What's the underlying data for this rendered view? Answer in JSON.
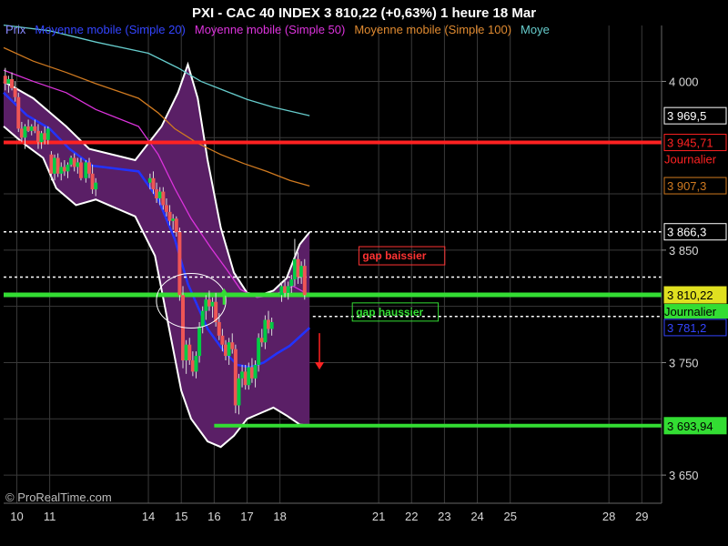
{
  "title": "PXI - CAC 40 INDEX     3 810,22 (+0,63%)     1 heure  18 Mar",
  "watermark": "© ProRealTime.com",
  "colors": {
    "background": "#000000",
    "band_fill": "#5a1f66",
    "band_edge": "#ffffff",
    "ma20": "#2233ff",
    "ma50": "#dd33dd",
    "ma100": "#d07a20",
    "ma200": "#66cccc",
    "candle_up": "#00cc44",
    "candle_down": "#ee5555",
    "red_line": "#ff2222",
    "green_line": "#33dd33"
  },
  "legend": [
    {
      "label": "Prix",
      "color": "#8888ff"
    },
    {
      "label": "Moyenne mobile (Simple 20)",
      "color": "#3344ff"
    },
    {
      "label": "Moyenne mobile (Simple 50)",
      "color": "#dd33dd"
    },
    {
      "label": "Moyenne mobile (Simple 100)",
      "color": "#e08a30"
    },
    {
      "label": "Moye",
      "color": "#66cccc"
    }
  ],
  "chart_data": {
    "type": "candlestick",
    "x_ticks": [
      {
        "label": "10",
        "x": 10
      },
      {
        "label": "11",
        "x": 11
      },
      {
        "label": "14",
        "x": 14
      },
      {
        "label": "15",
        "x": 15
      },
      {
        "label": "16",
        "x": 16
      },
      {
        "label": "17",
        "x": 17
      },
      {
        "label": "18",
        "x": 18
      },
      {
        "label": "21",
        "x": 21
      },
      {
        "label": "22",
        "x": 22
      },
      {
        "label": "23",
        "x": 23
      },
      {
        "label": "24",
        "x": 24
      },
      {
        "label": "25",
        "x": 25
      },
      {
        "label": "28",
        "x": 28
      },
      {
        "label": "29",
        "x": 29
      }
    ],
    "xlim": [
      9.6,
      29.6
    ],
    "ylim": [
      3625,
      4040
    ],
    "y_ticks": [
      {
        "label": "4 000",
        "value": 4000
      },
      {
        "label": "3 850",
        "value": 3850
      },
      {
        "label": "3 750",
        "value": 3750
      },
      {
        "label": "3 650",
        "value": 3650
      }
    ],
    "price_boxes": [
      {
        "label": "3 969,5",
        "value": 3969.5,
        "color": "#ffffff",
        "sub": ""
      },
      {
        "label": "3 945,71",
        "value": 3945.71,
        "color": "#ff2222",
        "sub": "Journalier"
      },
      {
        "label": "3 907,3",
        "value": 3907.3,
        "color": "#d07a20",
        "sub": ""
      },
      {
        "label": "3 866,3",
        "value": 3866.3,
        "color": "#ffffff",
        "sub": ""
      },
      {
        "label": "3 810,22",
        "value": 3810.22,
        "color": "#e0e020",
        "sub": ""
      },
      {
        "label": "3 781,2",
        "value": 3781.2,
        "color": "#3344ff",
        "sub": ""
      },
      {
        "label": "3 693,94",
        "value": 3693.94,
        "color": "#33dd33",
        "sub": ""
      }
    ],
    "green_sub_label": "Journalier",
    "candles": [
      {
        "x": 9.65,
        "o": 4005,
        "h": 4012,
        "l": 3992,
        "c": 3998
      },
      {
        "x": 9.75,
        "o": 3998,
        "h": 4005,
        "l": 3990,
        "c": 4002
      },
      {
        "x": 9.85,
        "o": 4002,
        "h": 4008,
        "l": 3992,
        "c": 3994
      },
      {
        "x": 9.95,
        "o": 3994,
        "h": 4000,
        "l": 3982,
        "c": 3986
      },
      {
        "x": 10.05,
        "o": 3986,
        "h": 3990,
        "l": 3955,
        "c": 3958
      },
      {
        "x": 10.15,
        "o": 3958,
        "h": 3964,
        "l": 3946,
        "c": 3950
      },
      {
        "x": 10.25,
        "o": 3950,
        "h": 3962,
        "l": 3940,
        "c": 3960
      },
      {
        "x": 10.35,
        "o": 3960,
        "h": 3966,
        "l": 3955,
        "c": 3956
      },
      {
        "x": 10.45,
        "o": 3956,
        "h": 3962,
        "l": 3952,
        "c": 3960
      },
      {
        "x": 10.55,
        "o": 3960,
        "h": 3966,
        "l": 3954,
        "c": 3956
      },
      {
        "x": 10.65,
        "o": 3956,
        "h": 3962,
        "l": 3940,
        "c": 3946
      },
      {
        "x": 10.75,
        "o": 3946,
        "h": 3956,
        "l": 3940,
        "c": 3954
      },
      {
        "x": 10.85,
        "o": 3954,
        "h": 3960,
        "l": 3944,
        "c": 3948
      },
      {
        "x": 10.95,
        "o": 3948,
        "h": 3960,
        "l": 3944,
        "c": 3958
      },
      {
        "x": 11.05,
        "o": 3935,
        "h": 3938,
        "l": 3912,
        "c": 3918
      },
      {
        "x": 11.15,
        "o": 3918,
        "h": 3935,
        "l": 3912,
        "c": 3932
      },
      {
        "x": 11.25,
        "o": 3932,
        "h": 3936,
        "l": 3915,
        "c": 3918
      },
      {
        "x": 11.35,
        "o": 3918,
        "h": 3928,
        "l": 3912,
        "c": 3924
      },
      {
        "x": 11.45,
        "o": 3924,
        "h": 3930,
        "l": 3916,
        "c": 3920
      },
      {
        "x": 11.55,
        "o": 3920,
        "h": 3928,
        "l": 3914,
        "c": 3926
      },
      {
        "x": 11.65,
        "o": 3926,
        "h": 3934,
        "l": 3924,
        "c": 3932
      },
      {
        "x": 11.75,
        "o": 3932,
        "h": 3936,
        "l": 3920,
        "c": 3924
      },
      {
        "x": 11.85,
        "o": 3924,
        "h": 3932,
        "l": 3918,
        "c": 3928
      },
      {
        "x": 11.95,
        "o": 3928,
        "h": 3932,
        "l": 3912,
        "c": 3914
      },
      {
        "x": 12.1,
        "o": 3914,
        "h": 3930,
        "l": 3910,
        "c": 3928
      },
      {
        "x": 12.2,
        "o": 3928,
        "h": 3932,
        "l": 3914,
        "c": 3918
      },
      {
        "x": 12.3,
        "o": 3918,
        "h": 3926,
        "l": 3900,
        "c": 3904
      },
      {
        "x": 12.4,
        "o": 3904,
        "h": 3914,
        "l": 3898,
        "c": 3910
      },
      {
        "x": 14.05,
        "o": 3910,
        "h": 3918,
        "l": 3904,
        "c": 3914
      },
      {
        "x": 14.15,
        "o": 3914,
        "h": 3920,
        "l": 3900,
        "c": 3904
      },
      {
        "x": 14.25,
        "o": 3904,
        "h": 3910,
        "l": 3892,
        "c": 3896
      },
      {
        "x": 14.35,
        "o": 3896,
        "h": 3906,
        "l": 3890,
        "c": 3902
      },
      {
        "x": 14.45,
        "o": 3902,
        "h": 3906,
        "l": 3886,
        "c": 3890
      },
      {
        "x": 14.55,
        "o": 3890,
        "h": 3896,
        "l": 3880,
        "c": 3884
      },
      {
        "x": 14.65,
        "o": 3884,
        "h": 3890,
        "l": 3872,
        "c": 3876
      },
      {
        "x": 14.75,
        "o": 3876,
        "h": 3882,
        "l": 3868,
        "c": 3878
      },
      {
        "x": 14.85,
        "o": 3878,
        "h": 3880,
        "l": 3862,
        "c": 3866
      },
      {
        "x": 14.95,
        "o": 3866,
        "h": 3870,
        "l": 3805,
        "c": 3810
      },
      {
        "x": 15.05,
        "o": 3810,
        "h": 3818,
        "l": 3745,
        "c": 3752
      },
      {
        "x": 15.15,
        "o": 3752,
        "h": 3770,
        "l": 3740,
        "c": 3766
      },
      {
        "x": 15.25,
        "o": 3766,
        "h": 3772,
        "l": 3748,
        "c": 3752
      },
      {
        "x": 15.35,
        "o": 3752,
        "h": 3760,
        "l": 3738,
        "c": 3742
      },
      {
        "x": 15.45,
        "o": 3742,
        "h": 3760,
        "l": 3736,
        "c": 3756
      },
      {
        "x": 15.55,
        "o": 3756,
        "h": 3786,
        "l": 3750,
        "c": 3782
      },
      {
        "x": 15.65,
        "o": 3782,
        "h": 3800,
        "l": 3776,
        "c": 3796
      },
      {
        "x": 15.75,
        "o": 3796,
        "h": 3810,
        "l": 3788,
        "c": 3806
      },
      {
        "x": 15.85,
        "o": 3806,
        "h": 3814,
        "l": 3796,
        "c": 3800
      },
      {
        "x": 15.95,
        "o": 3800,
        "h": 3808,
        "l": 3790,
        "c": 3804
      },
      {
        "x": 16.05,
        "o": 3804,
        "h": 3812,
        "l": 3782,
        "c": 3786
      },
      {
        "x": 16.15,
        "o": 3786,
        "h": 3794,
        "l": 3770,
        "c": 3774
      },
      {
        "x": 16.25,
        "o": 3774,
        "h": 3780,
        "l": 3760,
        "c": 3766
      },
      {
        "x": 16.35,
        "o": 3766,
        "h": 3770,
        "l": 3752,
        "c": 3756
      },
      {
        "x": 16.45,
        "o": 3756,
        "h": 3772,
        "l": 3748,
        "c": 3768
      },
      {
        "x": 16.55,
        "o": 3768,
        "h": 3776,
        "l": 3758,
        "c": 3762
      },
      {
        "x": 16.65,
        "o": 3762,
        "h": 3766,
        "l": 3705,
        "c": 3712
      },
      {
        "x": 16.75,
        "o": 3712,
        "h": 3740,
        "l": 3704,
        "c": 3736
      },
      {
        "x": 16.85,
        "o": 3736,
        "h": 3748,
        "l": 3728,
        "c": 3742
      },
      {
        "x": 16.95,
        "o": 3742,
        "h": 3748,
        "l": 3726,
        "c": 3730
      },
      {
        "x": 17.05,
        "o": 3730,
        "h": 3750,
        "l": 3726,
        "c": 3746
      },
      {
        "x": 17.15,
        "o": 3746,
        "h": 3754,
        "l": 3732,
        "c": 3736
      },
      {
        "x": 17.25,
        "o": 3736,
        "h": 3752,
        "l": 3728,
        "c": 3748
      },
      {
        "x": 17.35,
        "o": 3748,
        "h": 3776,
        "l": 3742,
        "c": 3772
      },
      {
        "x": 17.45,
        "o": 3772,
        "h": 3780,
        "l": 3764,
        "c": 3768
      },
      {
        "x": 17.55,
        "o": 3768,
        "h": 3792,
        "l": 3762,
        "c": 3788
      },
      {
        "x": 17.65,
        "o": 3788,
        "h": 3796,
        "l": 3776,
        "c": 3780
      },
      {
        "x": 17.75,
        "o": 3780,
        "h": 3790,
        "l": 3774,
        "c": 3786
      },
      {
        "x": 18.05,
        "o": 3810,
        "h": 3822,
        "l": 3804,
        "c": 3818
      },
      {
        "x": 18.15,
        "o": 3818,
        "h": 3824,
        "l": 3808,
        "c": 3812
      },
      {
        "x": 18.25,
        "o": 3812,
        "h": 3822,
        "l": 3806,
        "c": 3818
      },
      {
        "x": 18.35,
        "o": 3818,
        "h": 3828,
        "l": 3812,
        "c": 3824
      },
      {
        "x": 18.45,
        "o": 3824,
        "h": 3860,
        "l": 3818,
        "c": 3842
      },
      {
        "x": 18.55,
        "o": 3842,
        "h": 3848,
        "l": 3820,
        "c": 3826
      },
      {
        "x": 18.65,
        "o": 3826,
        "h": 3840,
        "l": 3820,
        "c": 3836
      },
      {
        "x": 18.75,
        "o": 3836,
        "h": 3842,
        "l": 3806,
        "c": 3810
      }
    ],
    "band_upper": [
      [
        9.6,
        4000
      ],
      [
        10.5,
        3985
      ],
      [
        11.5,
        3960
      ],
      [
        12.2,
        3940
      ],
      [
        13.6,
        3930
      ],
      [
        14.4,
        3960
      ],
      [
        14.9,
        3990
      ],
      [
        15.2,
        4015
      ],
      [
        15.5,
        3985
      ],
      [
        15.8,
        3930
      ],
      [
        16.2,
        3870
      ],
      [
        16.6,
        3830
      ],
      [
        17,
        3812
      ],
      [
        17.4,
        3810
      ],
      [
        17.8,
        3814
      ],
      [
        18.2,
        3825
      ],
      [
        18.6,
        3855
      ],
      [
        18.9,
        3866
      ]
    ],
    "band_lower": [
      [
        9.6,
        3960
      ],
      [
        10.2,
        3945
      ],
      [
        10.8,
        3932
      ],
      [
        11.2,
        3905
      ],
      [
        11.8,
        3890
      ],
      [
        12.4,
        3895
      ],
      [
        13.6,
        3880
      ],
      [
        14.2,
        3845
      ],
      [
        14.7,
        3770
      ],
      [
        15,
        3725
      ],
      [
        15.3,
        3700
      ],
      [
        15.8,
        3680
      ],
      [
        16.2,
        3675
      ],
      [
        16.6,
        3685
      ],
      [
        17,
        3700
      ],
      [
        17.4,
        3705
      ],
      [
        17.8,
        3710
      ],
      [
        18.2,
        3703
      ],
      [
        18.6,
        3695
      ],
      [
        18.9,
        3694
      ]
    ],
    "series": [
      {
        "name": "Moyenne mobile (Simple 20)",
        "color": "#2233ff",
        "points": [
          [
            9.6,
            3990
          ],
          [
            10.3,
            3970
          ],
          [
            11,
            3958
          ],
          [
            11.6,
            3940
          ],
          [
            12.3,
            3925
          ],
          [
            13.7,
            3920
          ],
          [
            14.3,
            3895
          ],
          [
            14.8,
            3860
          ],
          [
            15.2,
            3820
          ],
          [
            15.8,
            3780
          ],
          [
            16.3,
            3760
          ],
          [
            16.7,
            3748
          ],
          [
            17.1,
            3746
          ],
          [
            17.5,
            3750
          ],
          [
            17.9,
            3758
          ],
          [
            18.3,
            3765
          ],
          [
            18.9,
            3781
          ]
        ]
      },
      {
        "name": "Moyenne mobile (Simple 50)",
        "color": "#dd33dd",
        "points": [
          [
            9.6,
            4010
          ],
          [
            10.5,
            4000
          ],
          [
            11.5,
            3990
          ],
          [
            12.4,
            3975
          ],
          [
            13.7,
            3960
          ],
          [
            14.3,
            3935
          ],
          [
            14.8,
            3905
          ],
          [
            15.3,
            3878
          ],
          [
            15.9,
            3852
          ],
          [
            16.4,
            3832
          ],
          [
            16.8,
            3815
          ],
          [
            17.3,
            3808
          ],
          [
            17.8,
            3810
          ],
          [
            18.4,
            3818
          ],
          [
            18.9,
            3810
          ]
        ]
      },
      {
        "name": "Moyenne mobile (Simple 100)",
        "color": "#d07a20",
        "points": [
          [
            9.6,
            4030
          ],
          [
            10.5,
            4018
          ],
          [
            11.5,
            4008
          ],
          [
            12.4,
            3998
          ],
          [
            13.7,
            3985
          ],
          [
            14.3,
            3972
          ],
          [
            14.8,
            3958
          ],
          [
            15.5,
            3945
          ],
          [
            16.2,
            3935
          ],
          [
            16.9,
            3927
          ],
          [
            17.6,
            3920
          ],
          [
            18.3,
            3912
          ],
          [
            18.9,
            3907
          ]
        ]
      },
      {
        "name": "Moye",
        "color": "#66cccc",
        "points": [
          [
            9.6,
            4050
          ],
          [
            11,
            4045
          ],
          [
            12.4,
            4035
          ],
          [
            14,
            4025
          ],
          [
            14.9,
            4012
          ],
          [
            15.6,
            4000
          ],
          [
            16.3,
            3992
          ],
          [
            17,
            3984
          ],
          [
            17.8,
            3977
          ],
          [
            18.4,
            3973
          ],
          [
            18.9,
            3969.5
          ]
        ]
      }
    ],
    "hlines": [
      {
        "value": 3945.71,
        "color": "#ff2222",
        "width": 4,
        "dash": "",
        "x0": 9.6,
        "x1": 29.6
      },
      {
        "value": 3810.22,
        "color": "#33dd33",
        "width": 5,
        "dash": "",
        "x0": 9.6,
        "x1": 29.6
      },
      {
        "value": 3693.94,
        "color": "#33dd33",
        "width": 4,
        "dash": "",
        "x0": 16.0,
        "x1": 29.6
      },
      {
        "value": 3866.3,
        "color": "#ffffff",
        "width": 1.5,
        "dash": "3,3",
        "x0": 9.6,
        "x1": 29.6
      },
      {
        "value": 3826,
        "color": "#ffffff",
        "width": 1.5,
        "dash": "3,3",
        "x0": 9.6,
        "x1": 29.6
      },
      {
        "value": 3791,
        "color": "#ffffff",
        "width": 1.5,
        "dash": "3,3",
        "x0": 19.0,
        "x1": 29.6
      }
    ],
    "annotations": [
      {
        "text": "gap baissier",
        "color": "#ff3333",
        "x": 20.4,
        "value": 3845
      },
      {
        "text": "gap haussier",
        "color": "#33dd33",
        "x": 20.2,
        "value": 3795
      }
    ],
    "arrows": [
      {
        "dir": "up",
        "color": "#33dd33",
        "x": 16.3,
        "value": 3808
      },
      {
        "dir": "down",
        "color": "#ff2222",
        "x": 19.2,
        "value": 3760
      }
    ],
    "ellipse": {
      "x": 15.3,
      "value": 3805,
      "rx": 2.0,
      "ry": 30,
      "color": "#ffffff"
    }
  }
}
